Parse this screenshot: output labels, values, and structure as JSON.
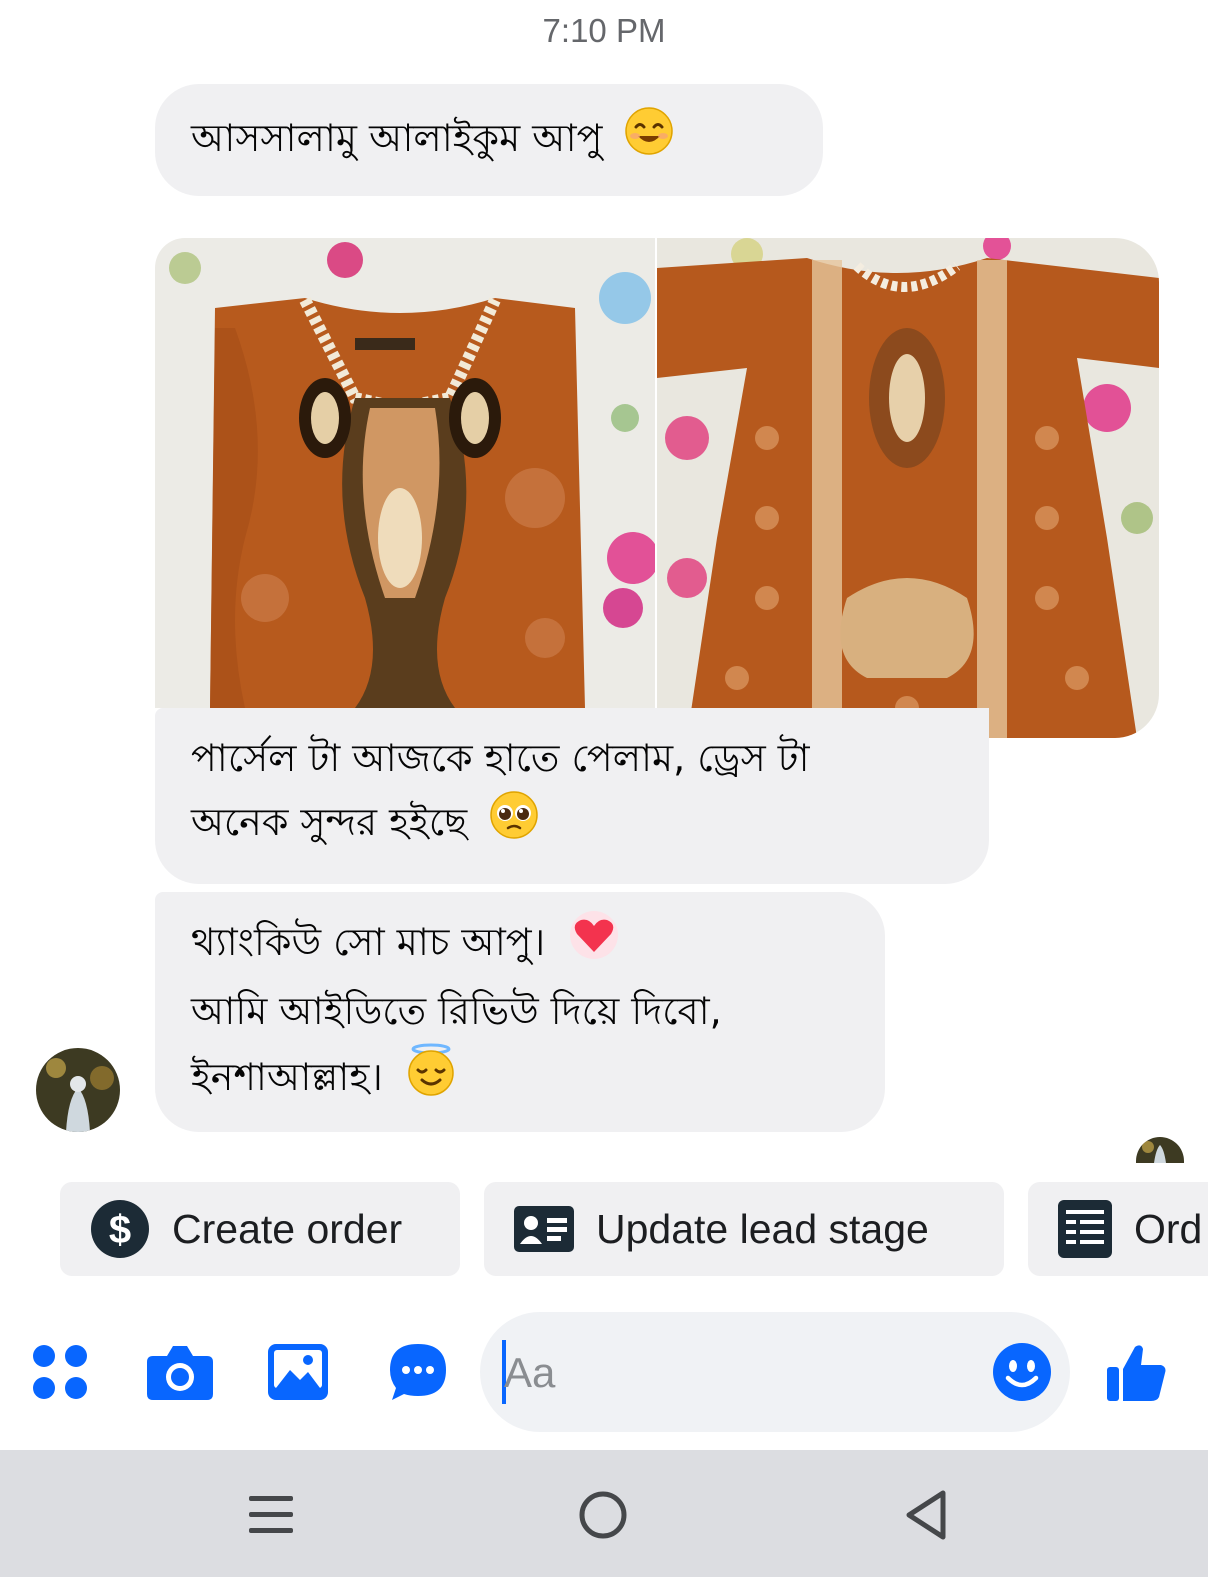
{
  "timestamp": "7:10 PM",
  "messages": [
    {
      "text": "আসসালামু আলাইকুম আপু",
      "emoji": "smiling-face-icon"
    },
    {
      "type": "photos",
      "count": 2
    },
    {
      "text_line1": "পার্সেল টা আজকে হাতে পেলাম, ড্রেস টা",
      "text_line2": "অনেক সুন্দর হইছে",
      "emoji": "pleading-face-icon"
    },
    {
      "text_line1": "থ্যাংকিউ সো মাচ আপু।",
      "text_line2": "আমি আইডিতে রিভিউ দিয়ে দিবো,",
      "text_line3": "ইনশাআল্লাহ।",
      "emoji1": "heart-icon",
      "emoji2": "smiling-halo-face-icon"
    }
  ],
  "quick_actions": {
    "create_order": "Create order",
    "update_lead_stage": "Update lead stage",
    "orders": "Ord"
  },
  "composer": {
    "placeholder": "Aa"
  },
  "colors": {
    "accent": "#0866ff",
    "bubble": "#f0f0f2",
    "dress": "#b85a1c"
  },
  "icons": {
    "menu": "apps-grid-icon",
    "camera": "camera-icon",
    "gallery": "image-icon",
    "chat": "chat-bubble-icon",
    "emoji": "emoji-icon",
    "like": "thumbs-up-icon"
  }
}
